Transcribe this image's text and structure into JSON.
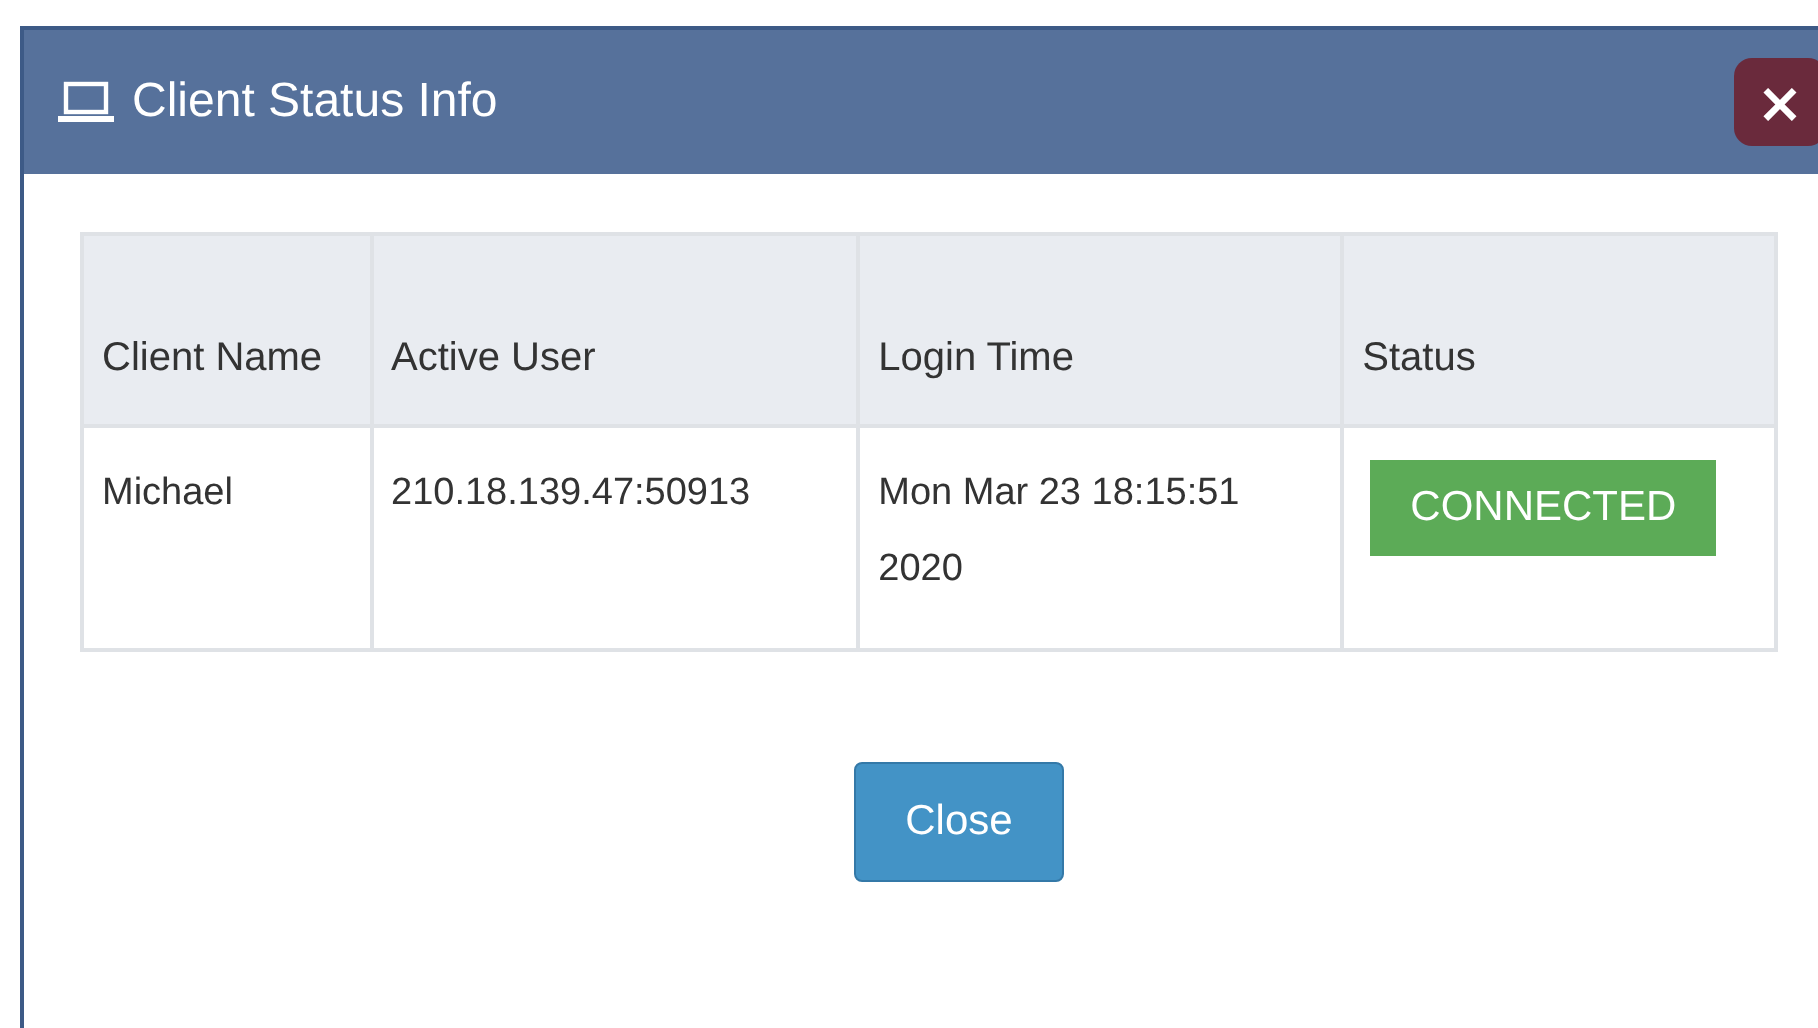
{
  "dialog": {
    "title": "Client Status Info",
    "close_symbol": "×"
  },
  "table": {
    "columns": [
      "Client Name",
      "Active User",
      "Login Time",
      "Status"
    ],
    "rows": [
      {
        "client_name": "Michael",
        "active_user": "210.18.139.47:50913",
        "login_time": "Mon Mar 23 18:15:51 2020",
        "status": {
          "label": "CONNECTED",
          "kind": "success"
        }
      }
    ]
  },
  "buttons": [
    "Close"
  ]
}
